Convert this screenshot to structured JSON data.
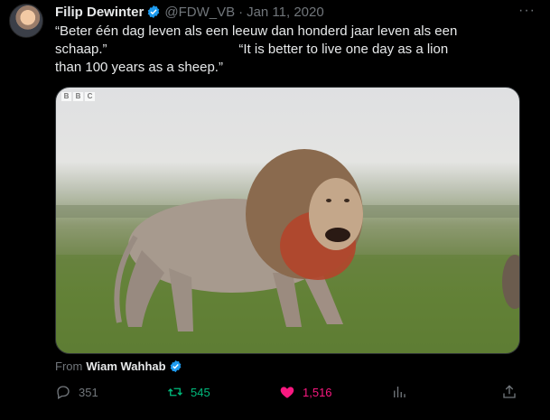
{
  "author": {
    "name": "Filip Dewinter",
    "handle": "@FDW_VB",
    "separator": "·",
    "date": "Jan 11, 2020"
  },
  "tweet_text": {
    "line1": "“Beter één dag leven als een leeuw dan honderd jaar leven als een",
    "line2": "schaap.”                                   “It is better to live one day as a lion",
    "line3": "than 100 years as a sheep.”"
  },
  "media": {
    "watermark": [
      "B",
      "B",
      "C"
    ]
  },
  "attribution": {
    "prefix": "From",
    "source": "Wiam Wahhab"
  },
  "actions": {
    "replies": "351",
    "retweets": "545",
    "likes": "1,516"
  },
  "colors": {
    "verified": "#1d9bf0",
    "retweet": "#00ba7c",
    "like": "#f91880",
    "muted": "#71767b"
  },
  "icons": [
    "verified-badge-icon",
    "more-icon",
    "reply-icon",
    "retweet-icon",
    "like-icon",
    "views-icon",
    "share-icon"
  ]
}
